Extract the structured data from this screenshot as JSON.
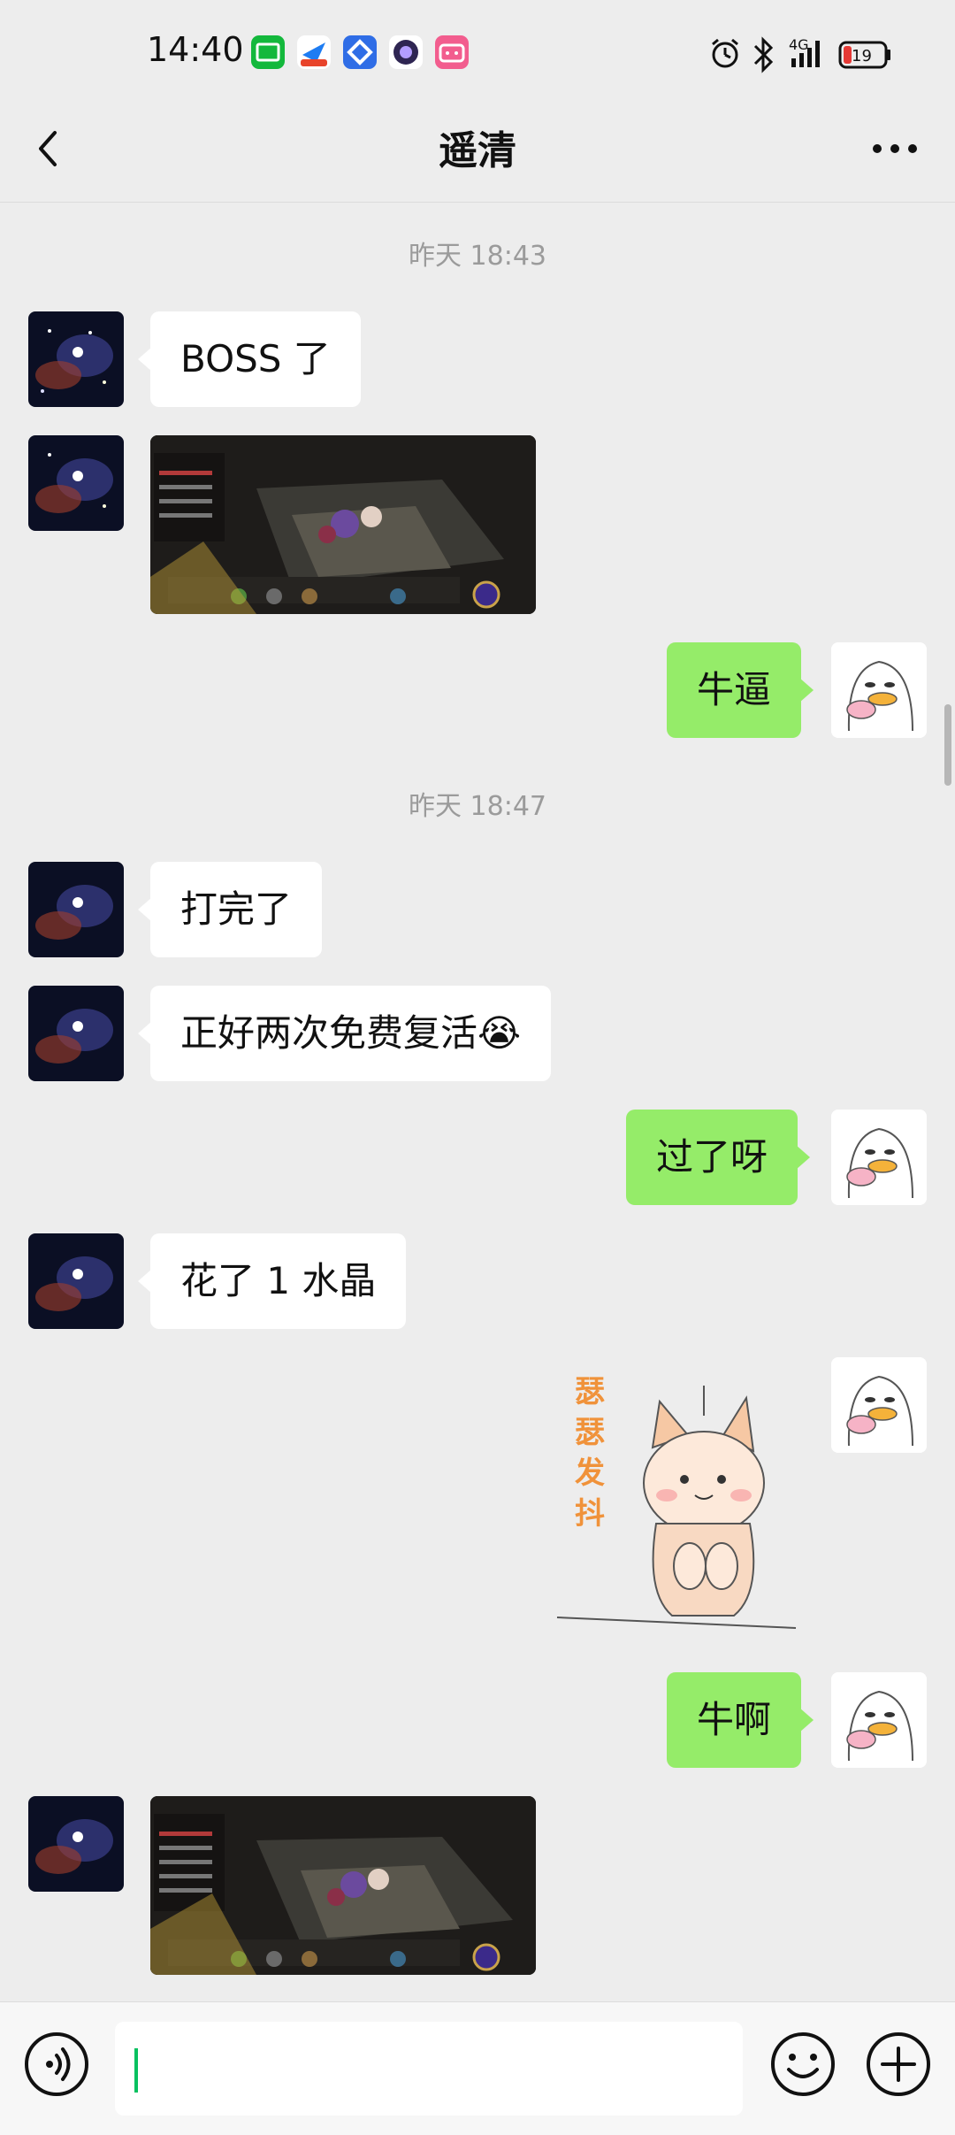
{
  "status_bar": {
    "time": "14:40",
    "battery": "19",
    "network": "4G"
  },
  "header": {
    "title": "遥清"
  },
  "timestamps": [
    "昨天 18:43",
    "昨天 18:47"
  ],
  "messages": {
    "m1": "BOSS 了",
    "m2": "牛逼",
    "m3": "打完了",
    "m4": "正好两次免费复活😭",
    "m5": "过了呀",
    "m6": "花了 1 水晶",
    "m7": "牛啊"
  },
  "sticker": {
    "text": "瑟瑟发抖"
  },
  "input": {
    "value": ""
  },
  "colors": {
    "out_bubble": "#95ec69",
    "in_bubble": "#ffffff",
    "background": "#ededed",
    "accent": "#07c160"
  },
  "icons": [
    "back-icon",
    "more-icon",
    "voice-icon",
    "emoji-icon",
    "plus-icon",
    "alarm-icon",
    "bluetooth-icon",
    "signal-icon",
    "battery-icon"
  ]
}
